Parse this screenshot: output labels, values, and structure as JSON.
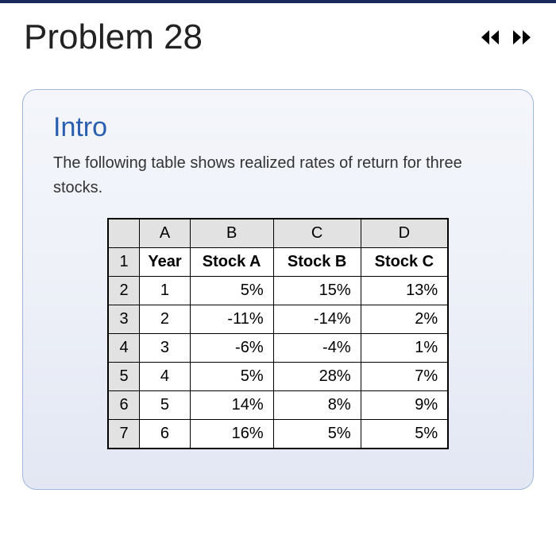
{
  "header": {
    "title": "Problem 28"
  },
  "card": {
    "heading": "Intro",
    "body": "The following table shows realized rates of return for three stocks."
  },
  "table": {
    "col_letters": [
      "A",
      "B",
      "C",
      "D"
    ],
    "headers": {
      "a": "Year",
      "b": "Stock A",
      "c": "Stock B",
      "d": "Stock C"
    },
    "rows": [
      {
        "n": "2",
        "year": "1",
        "a": "5%",
        "b": "15%",
        "c": "13%"
      },
      {
        "n": "3",
        "year": "2",
        "a": "-11%",
        "b": "-14%",
        "c": "2%"
      },
      {
        "n": "4",
        "year": "3",
        "a": "-6%",
        "b": "-4%",
        "c": "1%"
      },
      {
        "n": "5",
        "year": "4",
        "a": "5%",
        "b": "28%",
        "c": "7%"
      },
      {
        "n": "6",
        "year": "5",
        "a": "14%",
        "b": "8%",
        "c": "9%"
      },
      {
        "n": "7",
        "year": "6",
        "a": "16%",
        "b": "5%",
        "c": "5%"
      }
    ]
  },
  "chart_data": {
    "type": "table",
    "title": "Realized rates of return for three stocks",
    "columns": [
      "Year",
      "Stock A",
      "Stock B",
      "Stock C"
    ],
    "rows": [
      [
        1,
        "5%",
        "15%",
        "13%"
      ],
      [
        2,
        "-11%",
        "-14%",
        "2%"
      ],
      [
        3,
        "-6%",
        "-4%",
        "1%"
      ],
      [
        4,
        "5%",
        "28%",
        "7%"
      ],
      [
        5,
        "14%",
        "8%",
        "9%"
      ],
      [
        6,
        "16%",
        "5%",
        "5%"
      ]
    ]
  }
}
